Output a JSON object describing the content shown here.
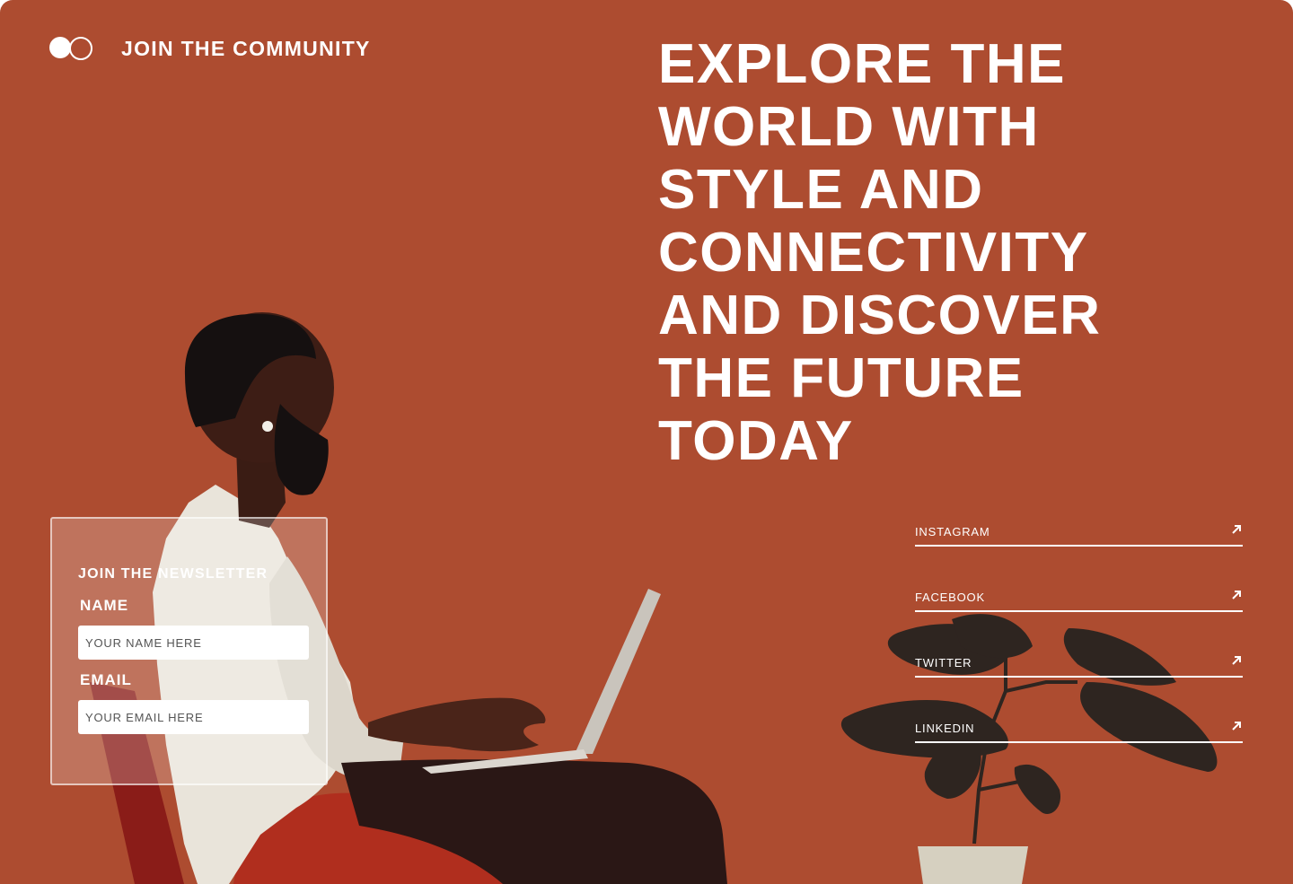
{
  "header": {
    "title": "JOIN THE COMMUNITY",
    "logo_icon": "two-circles-logo-icon"
  },
  "hero": {
    "headline": "EXPLORE THE WORLD WITH STYLE AND CONNECTIVITY AND DISCOVER THE FUTURE TODAY"
  },
  "newsletter": {
    "title": "JOIN THE NEWSLETTER",
    "name_label": "NAME",
    "name_placeholder": "YOUR NAME HERE",
    "email_label": "EMAIL",
    "email_placeholder": "YOUR EMAIL HERE"
  },
  "socials": [
    {
      "label": "INSTAGRAM",
      "icon": "arrow-up-right-icon"
    },
    {
      "label": "FACEBOOK",
      "icon": "arrow-up-right-icon"
    },
    {
      "label": "TWITTER",
      "icon": "arrow-up-right-icon"
    },
    {
      "label": "LINKEDIN",
      "icon": "arrow-up-right-icon"
    }
  ],
  "colors": {
    "background": "#ad4c30",
    "text": "#ffffff",
    "chair": "#b8301f",
    "plant": "#2e2520"
  }
}
